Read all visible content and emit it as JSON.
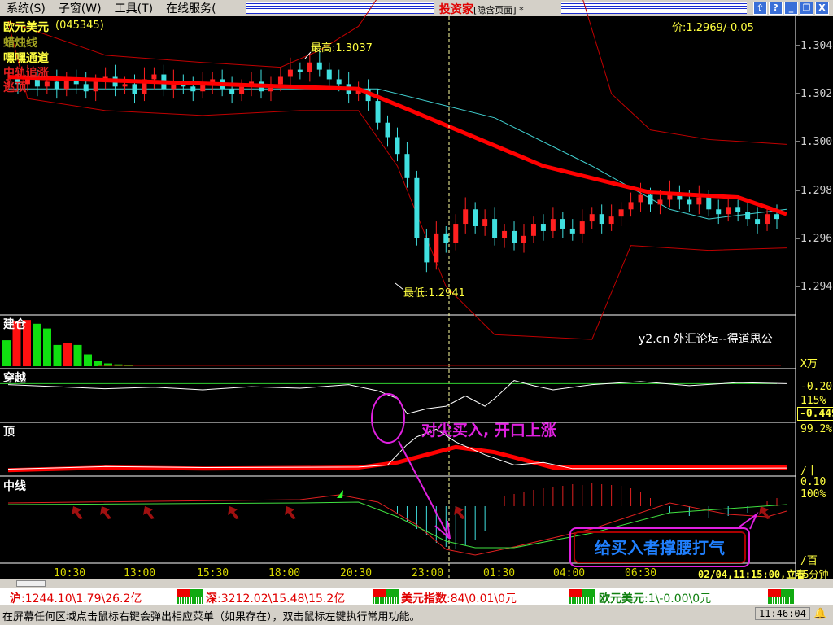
{
  "menu": [
    "系统(S)",
    "子窗(W)",
    "工具(T)",
    "在线服务("
  ],
  "app_title": "投资家",
  "app_subtitle": "[隐含页面] *",
  "window_buttons": [
    "⇧",
    "?",
    "_",
    "❐",
    "X"
  ],
  "main": {
    "symbol": "欧元美元",
    "code": "(045345)",
    "indicators": [
      "蜡烛线",
      "嘿嘿通道",
      "中轨追涨",
      "逃顶"
    ],
    "price_label": "价:1.2969/-0.05",
    "high_label": "最高:1.3037",
    "low_label": "最低:1.2941",
    "axis": [
      "1.304",
      "1.302",
      "1.300",
      "1.298",
      "1.296",
      "1.294"
    ]
  },
  "panels": {
    "jiancang": "建仓",
    "chuanyue": "穿越",
    "ding": "顶",
    "zhongxian": "中线"
  },
  "watermark": "y2.cn 外汇论坛--得道思公",
  "sub_axis": [
    "X万",
    "-0.20",
    "115%",
    "-0.449",
    "99.2%",
    "/十",
    "0.10",
    "100%",
    "/百"
  ],
  "annotations": {
    "a1": "对尖买入, 开口上涨",
    "a2": "给买入者撑腰打气"
  },
  "time_axis": [
    "10:30",
    "13:00",
    "15:30",
    "18:00",
    "20:30",
    "23:00",
    "01:30",
    "04:00",
    "06:30"
  ],
  "cursor_time": "02/04,11:15:00,立春",
  "period": "15分钟",
  "ticker": [
    {
      "name": "沪",
      "value": ":1244.10\\1.79\\26.2亿"
    },
    {
      "name": "深",
      "value": ":3212.02\\15.48\\15.2亿"
    },
    {
      "name": "美元指数",
      "value": ":84\\0.01\\0元"
    },
    {
      "name": "欧元美元",
      "value": ":1\\-0.00\\0元"
    }
  ],
  "status_text": "在屏幕任何区域点击鼠标右键会弹出相应菜单（如果存在），双击鼠标左键执行常用功能。",
  "clock": "11:46:04",
  "colors": {
    "up": "#ff2020",
    "down": "#40e0e0",
    "ma": "#ff0000",
    "accent": "#e020e0"
  },
  "chart_data": {
    "type": "candlestick",
    "ylim": [
      1.2935,
      1.3045
    ],
    "closes": [
      1.3026,
      1.3024,
      1.3027,
      1.3023,
      1.3025,
      1.3022,
      1.3026,
      1.3024,
      1.3021,
      1.3025,
      1.3027,
      1.3023,
      1.3024,
      1.302,
      1.3026,
      1.3028,
      1.3022,
      1.3025,
      1.3023,
      1.3021,
      1.3024,
      1.3026,
      1.3022,
      1.302,
      1.3023,
      1.3025,
      1.3021,
      1.3024,
      1.3027,
      1.303,
      1.3029,
      1.3033,
      1.303,
      1.3026,
      1.3024,
      1.302,
      1.3022,
      1.3017,
      1.3008,
      1.3002,
      1.2995,
      1.2985,
      1.296,
      1.295,
      1.2962,
      1.2958,
      1.2966,
      1.2972,
      1.2965,
      1.2968,
      1.296,
      1.2963,
      1.2958,
      1.2961,
      1.2966,
      1.2963,
      1.2968,
      1.2964,
      1.2962,
      1.2967,
      1.297,
      1.2966,
      1.2969,
      1.2972,
      1.2975,
      1.2978,
      1.2974,
      1.2976,
      1.2979,
      1.2976,
      1.2974,
      1.2977,
      1.2972,
      1.297,
      1.2973,
      1.2971,
      1.2968,
      1.2966,
      1.297,
      1.2968
    ],
    "ma_red": [
      [
        0,
        1.3027
      ],
      [
        36,
        1.3022
      ],
      [
        42,
        1.3012
      ],
      [
        55,
        1.299
      ],
      [
        66,
        1.2979
      ],
      [
        75,
        1.2977
      ],
      [
        80,
        1.297
      ]
    ],
    "ma_cyan": [
      [
        0,
        1.3022
      ],
      [
        38,
        1.3022
      ],
      [
        50,
        1.301
      ],
      [
        60,
        1.299
      ],
      [
        68,
        1.2972
      ],
      [
        72,
        1.2968
      ],
      [
        80,
        1.2972
      ]
    ],
    "band_upper": [
      [
        0,
        1.305
      ],
      [
        10,
        1.3036
      ],
      [
        20,
        1.3033
      ],
      [
        28,
        1.3031
      ],
      [
        32,
        1.3038
      ],
      [
        36,
        1.3048
      ],
      [
        38,
        1.306
      ],
      [
        59,
        1.306
      ],
      [
        62,
        1.302
      ],
      [
        66,
        1.3005
      ],
      [
        72,
        1.3001
      ],
      [
        80,
        1.2999
      ]
    ],
    "band_lower": [
      [
        0,
        1.305
      ],
      [
        2,
        1.3018
      ],
      [
        10,
        1.3013
      ],
      [
        20,
        1.3011
      ],
      [
        30,
        1.3013
      ],
      [
        36,
        1.3013
      ],
      [
        40,
        1.299
      ],
      [
        45,
        1.294
      ],
      [
        50,
        1.292
      ],
      [
        60,
        1.2918
      ],
      [
        64,
        1.2957
      ],
      [
        72,
        1.2955
      ],
      [
        80,
        1.2956
      ]
    ],
    "jiancang": [
      {
        "v": 0.55,
        "c": "g"
      },
      {
        "v": 0.95,
        "c": "r"
      },
      {
        "v": 0.98,
        "c": "r"
      },
      {
        "v": 0.9,
        "c": "g"
      },
      {
        "v": 0.8,
        "c": "g"
      },
      {
        "v": 0.45,
        "c": "g"
      },
      {
        "v": 0.5,
        "c": "r"
      },
      {
        "v": 0.45,
        "c": "g"
      },
      {
        "v": 0.25,
        "c": "g"
      },
      {
        "v": 0.12,
        "c": "g"
      },
      {
        "v": 0.06,
        "c": "g"
      },
      {
        "v": 0.04,
        "c": "g"
      },
      {
        "v": 0.02,
        "c": "g"
      }
    ],
    "chuanyue_white": [
      [
        0,
        72
      ],
      [
        5,
        68
      ],
      [
        10,
        64
      ],
      [
        15,
        67
      ],
      [
        20,
        62
      ],
      [
        25,
        68
      ],
      [
        30,
        65
      ],
      [
        35,
        72
      ],
      [
        38,
        60
      ],
      [
        40,
        45
      ],
      [
        41,
        15
      ],
      [
        43,
        25
      ],
      [
        45,
        30
      ],
      [
        47,
        50
      ],
      [
        49,
        30
      ],
      [
        50,
        45
      ],
      [
        52,
        80
      ],
      [
        54,
        70
      ],
      [
        56,
        62
      ],
      [
        60,
        72
      ],
      [
        65,
        78
      ],
      [
        70,
        70
      ],
      [
        75,
        76
      ],
      [
        80,
        74
      ]
    ],
    "chuanyue_green": 74,
    "ding_red": [
      [
        0,
        10
      ],
      [
        10,
        15
      ],
      [
        20,
        13
      ],
      [
        36,
        15
      ],
      [
        40,
        25
      ],
      [
        46,
        55
      ],
      [
        50,
        45
      ],
      [
        56,
        15
      ],
      [
        80,
        15
      ]
    ],
    "ding_white": [
      [
        0,
        12
      ],
      [
        10,
        17
      ],
      [
        20,
        15
      ],
      [
        36,
        16
      ],
      [
        39,
        20
      ],
      [
        41,
        60
      ],
      [
        42,
        75
      ],
      [
        44,
        90
      ],
      [
        46,
        65
      ],
      [
        49,
        40
      ],
      [
        52,
        20
      ],
      [
        55,
        25
      ],
      [
        58,
        13
      ],
      [
        80,
        14
      ]
    ],
    "zx_green": [
      [
        0,
        70
      ],
      [
        30,
        72
      ],
      [
        36,
        73
      ],
      [
        40,
        55
      ],
      [
        45,
        25
      ],
      [
        48,
        17
      ],
      [
        52,
        17
      ],
      [
        60,
        35
      ],
      [
        68,
        60
      ],
      [
        74,
        65
      ],
      [
        80,
        70
      ]
    ],
    "zx_red": [
      [
        0,
        72
      ],
      [
        30,
        76
      ],
      [
        34,
        82
      ],
      [
        38,
        73
      ],
      [
        42,
        45
      ],
      [
        45,
        15
      ],
      [
        48,
        8
      ],
      [
        52,
        18
      ],
      [
        60,
        40
      ],
      [
        68,
        72
      ],
      [
        74,
        58
      ],
      [
        78,
        55
      ],
      [
        80,
        62
      ]
    ],
    "zx_hist": [
      [
        40,
        -10
      ],
      [
        41,
        -20
      ],
      [
        42,
        -28
      ],
      [
        43,
        -36
      ],
      [
        44,
        -45
      ],
      [
        45,
        -50
      ],
      [
        46,
        -52
      ],
      [
        47,
        -48
      ],
      [
        48,
        -42
      ],
      [
        49,
        -30
      ],
      [
        51,
        12
      ],
      [
        52,
        15
      ],
      [
        53,
        18
      ],
      [
        54,
        20
      ],
      [
        55,
        22
      ],
      [
        56,
        24
      ],
      [
        57,
        25
      ],
      [
        58,
        27
      ],
      [
        59,
        26
      ],
      [
        60,
        28
      ],
      [
        61,
        27
      ],
      [
        62,
        26
      ],
      [
        63,
        25
      ],
      [
        64,
        22
      ],
      [
        65,
        18
      ],
      [
        66,
        10
      ],
      [
        68,
        -8
      ],
      [
        70,
        -12
      ],
      [
        72,
        -14
      ],
      [
        74,
        -12
      ],
      [
        76,
        -8
      ],
      [
        78,
        6
      ],
      [
        79,
        10
      ]
    ]
  }
}
